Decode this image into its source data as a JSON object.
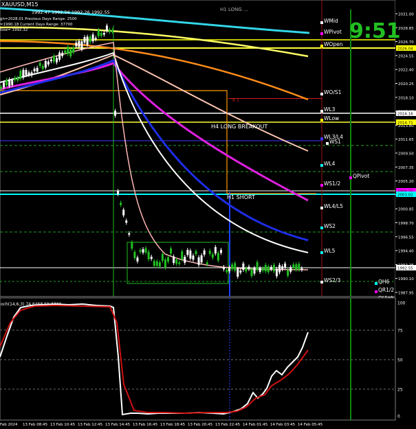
{
  "chart_header": {
    "symbol": "XAUUSD,M15",
    "ohlc": "1992.47 1992.56 1992.26 1992.55",
    "info_line1": "gh=2028.01   Previous Days Range: 2500",
    "info_line2": "=1990.18   Current Days Range: 37700",
    "info_line3": "lose= 1992.32",
    "top_label": "H1 LONG ...",
    "clock": "9:51"
  },
  "price_axis": {
    "ticks": [
      "2031.00",
      "2028.85",
      "2026.70",
      "2024.55",
      "2022.40",
      "2020.25",
      "2018.10",
      "2015.95",
      "2013.80",
      "2011.65",
      "2009.50",
      "2007.35",
      "2005.20",
      "2003.05",
      "2000.85",
      "1998.70",
      "1996.55",
      "1994.40",
      "1992.25",
      "1990.10",
      "1987.95"
    ],
    "tags": [
      {
        "text": "2026.04",
        "bg": "#ffff00",
        "fg": "#000000"
      },
      {
        "text": "2016.16",
        "bg": "#ffffff",
        "fg": "#000000"
      },
      {
        "text": "2014.71",
        "bg": "#ffff00",
        "fg": "#000000"
      },
      {
        "text": "2004.31",
        "bg": "#ff00ff",
        "fg": "#000000"
      },
      {
        "text": "2003.02",
        "bg": "#00ffff",
        "fg": "#000000"
      },
      {
        "text": "1992.55",
        "bg": "#ffffff",
        "fg": "#000000"
      }
    ]
  },
  "level_labels": [
    "WMid",
    "WPivot",
    "WOpen",
    "WO/S1",
    "WL3",
    "WLow",
    "WL3/L4",
    "WS1",
    "WL4",
    "QPivot",
    "WS1/2",
    "WL4/L5",
    "WS2",
    "WL5",
    "WS2/3",
    "QH6",
    "QR1/2",
    "QHigh"
  ],
  "annotations": {
    "h4_long_breakout": "H4 LONG BREAKOUT",
    "h1_short": "H1 SHORT",
    "r1": "R 1"
  },
  "stoch": {
    "title": "och(14,6,3) 74.6468 59.3719",
    "levels": [
      "100",
      "75",
      "50",
      "25",
      "0"
    ]
  },
  "time_axis": [
    "Feb 2024",
    "13 Feb 08:45",
    "13 Feb 10:45",
    "13 Feb 12:45",
    "13 Feb 14:45",
    "13 Feb 16:45",
    "13 Feb 18:45",
    "13 Feb 20:45",
    "13 Feb 22:45",
    "14 Feb 01:45",
    "14 Feb 03:45",
    "14 Feb 05:45"
  ],
  "colors": {
    "background": "#000000",
    "cyan_ma": "#33d6e8",
    "yellow_ma": "#ffff66",
    "orange_ma": "#ff8c1a",
    "peach_ma": "#ffc8b4",
    "magenta_ma": "#e020e0",
    "blue_ma": "#1e2ee8",
    "white_ma": "#ffffff",
    "bull": "#22c022",
    "bear": "#ffffff",
    "stoch_main": "#ffffff",
    "stoch_signal": "#d01010"
  }
}
